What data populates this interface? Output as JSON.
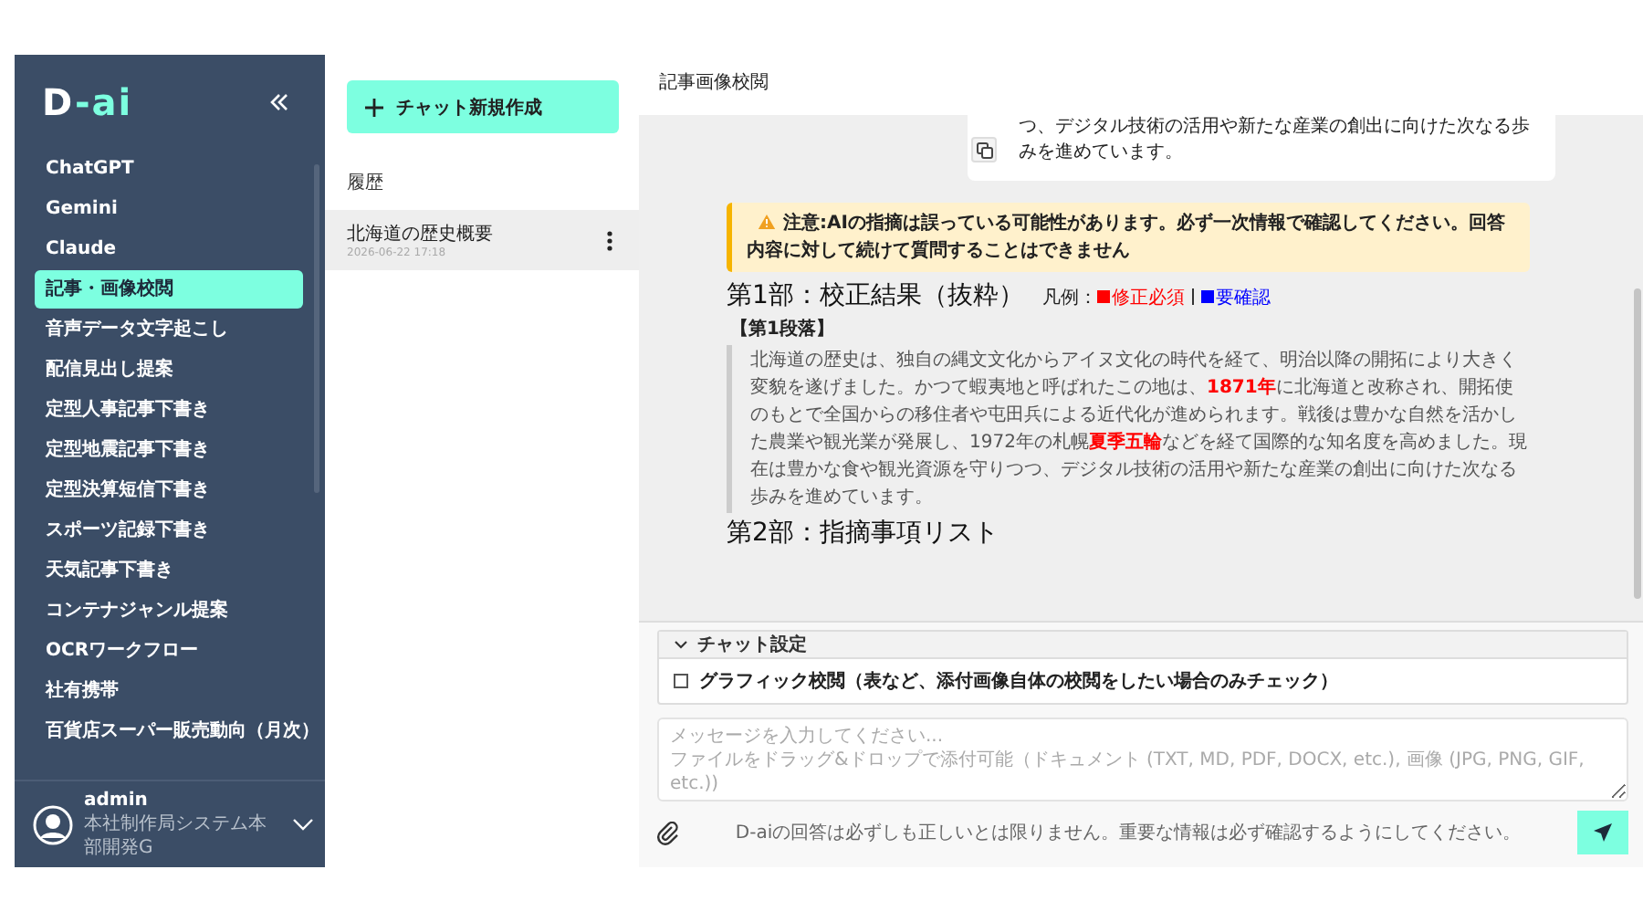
{
  "sidebar": {
    "logo": {
      "prefix": "D",
      "suffix": "-ai"
    },
    "items": [
      {
        "label": "ChatGPT",
        "selected": false
      },
      {
        "label": "Gemini",
        "selected": false
      },
      {
        "label": "Claude",
        "selected": false
      },
      {
        "label": "記事・画像校閲",
        "selected": true
      },
      {
        "label": "音声データ文字起こし",
        "selected": false
      },
      {
        "label": "配信見出し提案",
        "selected": false
      },
      {
        "label": "定型人事記事下書き",
        "selected": false
      },
      {
        "label": "定型地震記事下書き",
        "selected": false
      },
      {
        "label": "定型決算短信下書き",
        "selected": false
      },
      {
        "label": "スポーツ記録下書き",
        "selected": false
      },
      {
        "label": "天気記事下書き",
        "selected": false
      },
      {
        "label": "コンテナジャンル提案",
        "selected": false
      },
      {
        "label": "OCRワークフロー",
        "selected": false
      },
      {
        "label": "社有携帯",
        "selected": false
      },
      {
        "label": "百貨店スーパー販売動向（月次）",
        "selected": false
      }
    ],
    "user": {
      "name": "admin",
      "org": "本社制作局システム本部開発G"
    }
  },
  "history": {
    "new_chat": "チャット新規作成",
    "title": "履歴",
    "items": [
      {
        "title": "北海道の歴史概要",
        "time": "2026-06-22 17:18",
        "selected": true
      }
    ]
  },
  "main": {
    "title": "記事画像校閲",
    "message": "つ、デジタル技術の活用や新たな産業の創出に向けた次なる歩みを進めています。",
    "warning": "注意:AIの指摘は誤っている可能性があります。必ず一次情報で確認してください。回答内容に対して続けて質問することはできません",
    "section1": "第1部：校正結果（抜粋）",
    "legend_label": "凡例：",
    "legend": [
      {
        "label": "修正必須",
        "color": "#ff0000"
      },
      {
        "label": "要確認",
        "color": "#0000ff"
      }
    ],
    "paragraph_title": "【第1段落】",
    "paragraph": [
      {
        "kind": "plain",
        "text": "北海道の歴史は、独自の縄文文化からアイヌ文化の時代を経て、明治以降の開拓により大きく変貌を遂げました。かつて蝦夷地と呼ばれたこの地は、"
      },
      {
        "kind": "fix",
        "text": "1871年"
      },
      {
        "kind": "plain",
        "text": "に北海道と改称され、開拓使のもとで全国からの移住者や屯田兵による近代化が進められます。戦後は豊かな自然を活かした農業や観光業が発展し、1972年の札幌"
      },
      {
        "kind": "fix",
        "text": "夏季五輪"
      },
      {
        "kind": "plain",
        "text": "などを経て国際的な知名度を高めました。現在は豊かな食や観光資源を守りつつ、デジタル技術の活用や新たな産業の創出に向けた次なる歩みを進めています。"
      }
    ],
    "section2": "第2部：指摘事項リスト"
  },
  "chat_settings": {
    "title": "チャット設定",
    "expanded": true,
    "options": [
      {
        "label": "グラフィック校閲（表など、添付画像自体の校閲をしたい場合のみチェック）",
        "checked": false
      }
    ]
  },
  "input": {
    "placeholder": "メッセージを入力してください...\nファイルをドラッグ&ドロップで添付可能（ドキュメント (TXT, MD, PDF, DOCX, etc.), 画像 (JPG, PNG, GIF, etc.))"
  },
  "disclaimer": "D-aiの回答は必ずしも正しいとは限りません。重要な情報は必ず確認するようにしてください。"
}
